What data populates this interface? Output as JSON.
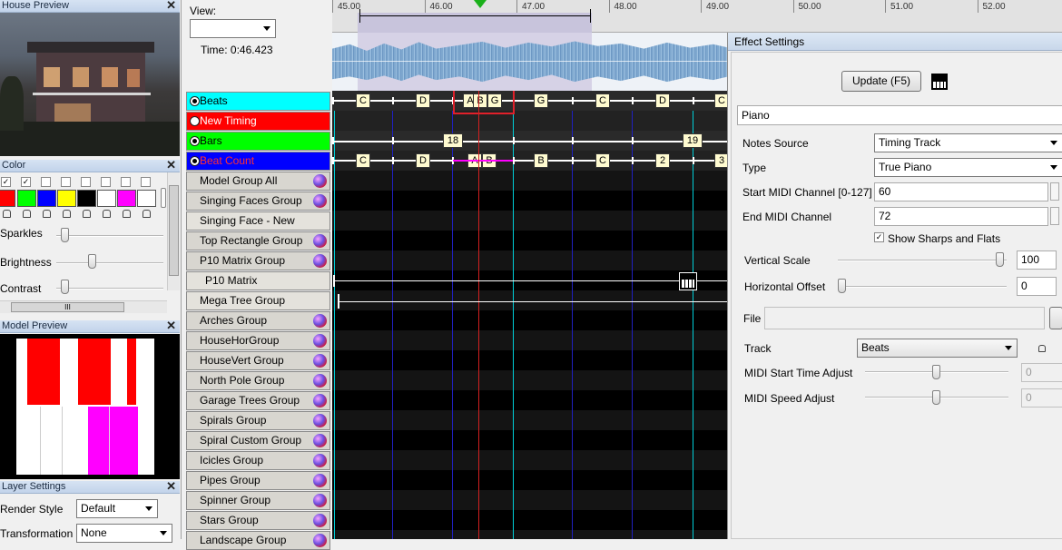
{
  "house_preview": {
    "title": "House Preview"
  },
  "color_panel": {
    "title": "Color",
    "checkboxes": [
      true,
      true,
      false,
      false,
      false,
      false,
      false,
      false
    ],
    "swatches": [
      "#ff0000",
      "#00ff00",
      "#0000ff",
      "#ffff00",
      "#000000",
      "#ffffff",
      "#ff00ff",
      "#ffffff"
    ],
    "sparkles_label": "Sparkles",
    "brightness_label": "Brightness",
    "contrast_label": "Contrast",
    "scroll_grip": "III"
  },
  "model_preview": {
    "title": "Model Preview"
  },
  "layer_settings": {
    "title": "Layer Settings",
    "render_style_label": "Render Style",
    "render_style_value": "Default",
    "transformation_label": "Transformation",
    "transformation_value": "None"
  },
  "timeline": {
    "view_label": "View:",
    "time_label": "Time: 0:46.423",
    "ruler": [
      "45.00",
      "46.00",
      "47.00",
      "48.00",
      "49.00",
      "50.00",
      "51.00",
      "52.00"
    ],
    "timing_tracks": [
      {
        "name": "Beats",
        "color": "#00ffff",
        "selected": true
      },
      {
        "name": "New Timing",
        "color": "#ff0000",
        "selected": false
      },
      {
        "name": "Bars",
        "color": "#00ff00",
        "selected": true
      },
      {
        "name": "Beat Count",
        "color": "#0000ff",
        "selected": true
      }
    ],
    "beats_marks": [
      "C",
      "D",
      "A",
      "B",
      "G",
      "G",
      "C",
      "D",
      "C"
    ],
    "bars_marks": [
      "18",
      "19"
    ],
    "beatcount_marks": [
      "C",
      "D",
      "A",
      "B",
      "B",
      "C",
      "2",
      "3"
    ],
    "models": [
      {
        "name": "Model Group All",
        "group": true
      },
      {
        "name": "Singing Faces Group",
        "group": true
      },
      {
        "name": "Singing Face - New",
        "group": false
      },
      {
        "name": "Top Rectangle Group",
        "group": true
      },
      {
        "name": "P10 Matrix Group",
        "group": true
      },
      {
        "name": "P10 Matrix",
        "group": false
      },
      {
        "name": "Mega Tree Group",
        "group": false
      },
      {
        "name": "Arches Group",
        "group": true
      },
      {
        "name": "HouseHorGroup",
        "group": true
      },
      {
        "name": "HouseVert Group",
        "group": true
      },
      {
        "name": "North Pole Group",
        "group": true
      },
      {
        "name": "Garage Trees Group",
        "group": true
      },
      {
        "name": "Spirals Group",
        "group": true
      },
      {
        "name": "Spiral Custom Group",
        "group": true
      },
      {
        "name": "Icicles Group",
        "group": true
      },
      {
        "name": "Pipes Group",
        "group": true
      },
      {
        "name": "Spinner Group",
        "group": true
      },
      {
        "name": "Stars Group",
        "group": true
      },
      {
        "name": "Landscape Group",
        "group": true
      }
    ]
  },
  "effect_settings": {
    "title": "Effect Settings",
    "update_button": "Update (F5)",
    "effect_name": "Piano",
    "notes_source_label": "Notes Source",
    "notes_source_value": "Timing Track",
    "type_label": "Type",
    "type_value": "True Piano",
    "start_midi_label": "Start MIDI Channel [0-127]",
    "start_midi_value": "60",
    "end_midi_label": "End MIDI Channel",
    "end_midi_value": "72",
    "show_sharps_label": "Show Sharps and Flats",
    "show_sharps_checked": true,
    "vertical_scale_label": "Vertical Scale",
    "vertical_scale_value": "100",
    "horizontal_offset_label": "Horizontal Offset",
    "horizontal_offset_value": "0",
    "file_label": "File",
    "file_value": "",
    "track_label": "Track",
    "track_value": "Beats",
    "midi_start_label": "MIDI Start Time Adjust",
    "midi_start_value": "0",
    "midi_speed_label": "MIDI Speed Adjust",
    "midi_speed_value": "0"
  }
}
